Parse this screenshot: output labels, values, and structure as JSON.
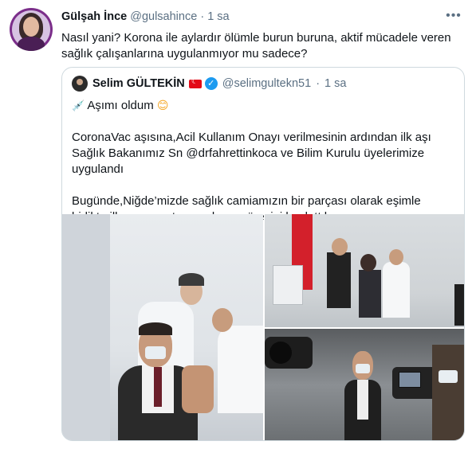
{
  "tweet": {
    "author_name": "Gülşah İnce",
    "author_handle": "@gulsahince",
    "separator": "·",
    "time": "1 sa",
    "more_icon": "more-horizontal-icon",
    "text": "Nasıl yani? Korona ile aylardır ölümle burun buruna, aktif mücadele veren sağlık çalışanlarına uygulanmıyor mu sadece?"
  },
  "quoted": {
    "author_name": "Selim GÜLTEKİN",
    "author_handle": "@selimgultekn51",
    "separator": "·",
    "time": "1 sa",
    "flag_icon": "turkey-flag-icon",
    "verified_icon": "verified-badge-icon",
    "line1": "Aşımı oldum",
    "line2": "CoronaVac aşısına,Acil Kullanım Onayı verilmesinin ardından ilk aşı Sağlık Bakanımız Sn @drfahrettinkoca ve Bilim Kurulu üyelerimize uygulandı",
    "line3": "Bugünde,Niğde’mizde sağlık camiamızın bir parçası olarak eşimle birlikte ilk aşıyı yaptırıp aşılama sürecini başlattık"
  },
  "colors": {
    "text": "#0f1419",
    "secondary": "#5b7083",
    "border": "#cfd9de",
    "verified": "#1d9bf0",
    "flag": "#e30a17"
  }
}
